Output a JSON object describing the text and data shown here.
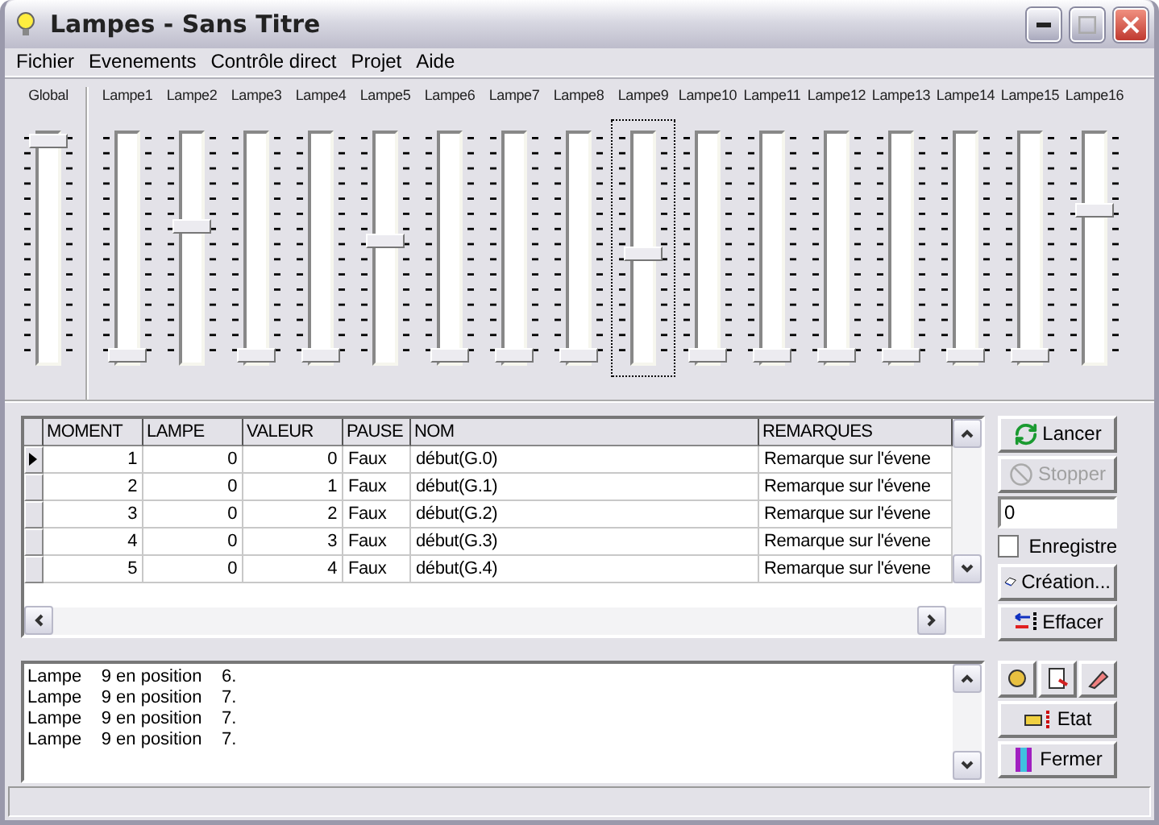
{
  "window": {
    "title": "Lampes - Sans Titre"
  },
  "menu": [
    "Fichier",
    "Evenements",
    "Contrôle direct",
    "Projet",
    "Aide"
  ],
  "global_slider": {
    "label": "Global",
    "level": 1
  },
  "lamp_sliders": [
    {
      "label": "Lampe1",
      "level": 0,
      "focused": false
    },
    {
      "label": "Lampe2",
      "level": 0.6,
      "focused": false
    },
    {
      "label": "Lampe3",
      "level": 0,
      "focused": false
    },
    {
      "label": "Lampe4",
      "level": 0,
      "focused": false
    },
    {
      "label": "Lampe5",
      "level": 0.53,
      "focused": false
    },
    {
      "label": "Lampe6",
      "level": 0,
      "focused": false
    },
    {
      "label": "Lampe7",
      "level": 0,
      "focused": false
    },
    {
      "label": "Lampe8",
      "level": 0,
      "focused": false
    },
    {
      "label": "Lampe9",
      "level": 0.47,
      "focused": true
    },
    {
      "label": "Lampe10",
      "level": 0,
      "focused": false
    },
    {
      "label": "Lampe11",
      "level": 0,
      "focused": false
    },
    {
      "label": "Lampe12",
      "level": 0,
      "focused": false
    },
    {
      "label": "Lampe13",
      "level": 0,
      "focused": false
    },
    {
      "label": "Lampe14",
      "level": 0,
      "focused": false
    },
    {
      "label": "Lampe15",
      "level": 0,
      "focused": false
    },
    {
      "label": "Lampe16",
      "level": 0.67,
      "focused": false
    }
  ],
  "table": {
    "columns": [
      "MOMENT",
      "LAMPE",
      "VALEUR",
      "PAUSE",
      "NOM",
      "REMARQUES"
    ],
    "rows": [
      {
        "cells": [
          "1",
          "0",
          "0",
          "Faux",
          "début(G.0)",
          "Remarque sur l'évene"
        ],
        "selected": true
      },
      {
        "cells": [
          "2",
          "0",
          "1",
          "Faux",
          "début(G.1)",
          "Remarque sur l'évene"
        ],
        "selected": false
      },
      {
        "cells": [
          "3",
          "0",
          "2",
          "Faux",
          "début(G.2)",
          "Remarque sur l'évene"
        ],
        "selected": false
      },
      {
        "cells": [
          "4",
          "0",
          "3",
          "Faux",
          "début(G.3)",
          "Remarque sur l'évene"
        ],
        "selected": false
      },
      {
        "cells": [
          "5",
          "0",
          "4",
          "Faux",
          "début(G.4)",
          "Remarque sur l'évene"
        ],
        "selected": false
      }
    ]
  },
  "side_controls": {
    "lancer": {
      "label": "Lancer",
      "disabled": false
    },
    "stopper": {
      "label": "Stopper",
      "disabled": true
    },
    "value": "0",
    "record": {
      "label": "Enregistre",
      "checked": false
    },
    "creation": {
      "label": "Création..."
    },
    "effacer": {
      "label": "Effacer"
    }
  },
  "log": [
    "Lampe    9 en position    6.",
    "Lampe    9 en position    7.",
    "Lampe    9 en position    7.",
    "Lampe    9 en position    7."
  ],
  "bottom_buttons": {
    "etat": "Etat",
    "fermer": "Fermer"
  }
}
